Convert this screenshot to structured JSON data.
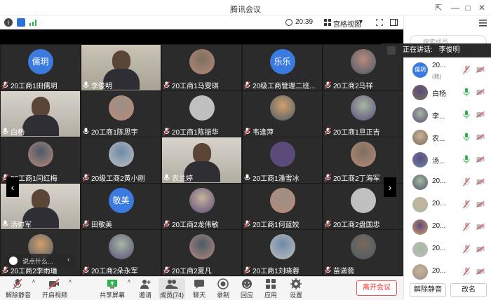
{
  "window": {
    "title": "腾讯会议",
    "pin": "⇱",
    "minimize": "—",
    "maximize": "□",
    "close": "✕"
  },
  "status": {
    "time": "20:39",
    "view": "宫格视图",
    "view_caret": "▾"
  },
  "video": {
    "prev_arrow": "‹",
    "next_arrow": "›",
    "tiles": [
      {
        "name": "20工商1田儒玥",
        "avatar_text": "儒玥",
        "muted": true
      },
      {
        "name": "李俊明",
        "video": true,
        "muted": false,
        "speaking": true
      },
      {
        "name": "20工商1马雯琪",
        "muted": true
      },
      {
        "name": "20级工商管理二班...",
        "avatar_text": "乐乐",
        "muted": true
      },
      {
        "name": "20工商2马祥",
        "muted": true
      },
      {
        "name": "白杨",
        "video": true,
        "muted": false
      },
      {
        "name": "20工商1陈思宇",
        "muted": false
      },
      {
        "name": "20工商1陈振华",
        "muted": true
      },
      {
        "name": "韦逢萍",
        "muted": true
      },
      {
        "name": "20工商1旦正吉",
        "muted": true
      },
      {
        "name": "20工商1闫红梅",
        "muted": true
      },
      {
        "name": "20级工商2黄小刚",
        "muted": true
      },
      {
        "name": "农兰婷",
        "video": true,
        "muted": false
      },
      {
        "name": "20工商1潘雪冰",
        "muted": false
      },
      {
        "name": "20工商2丁海军",
        "muted": true
      },
      {
        "name": "汤帅军",
        "video": true,
        "muted": false
      },
      {
        "name": "田敬美",
        "avatar_text": "敬美",
        "muted": true
      },
      {
        "name": "20工商2龙伟敏",
        "muted": true
      },
      {
        "name": "20工商1何蓝姣",
        "muted": true
      },
      {
        "name": "20工商2盘国忠",
        "muted": true
      },
      {
        "name": "20工商2李雨璠",
        "muted": true
      },
      {
        "name": "20工商2朵永军",
        "muted": true
      },
      {
        "name": "20工商2夏凡",
        "muted": true
      },
      {
        "name": "20工商1刘晓蓉",
        "muted": true
      },
      {
        "name": "苗潇蓊",
        "muted": true
      }
    ],
    "chat_placeholder": "说点什么..."
  },
  "toolbar": {
    "unmute": "解除静音",
    "start_video": "开启视频",
    "share": "共享屏幕",
    "invite": "邀请",
    "members": "成员(74)",
    "chat": "聊天",
    "record": "录制",
    "applause": "回应",
    "apps": "应用",
    "settings": "设置",
    "leave": "离开会议"
  },
  "panel": {
    "search_placeholder": "搜索成员",
    "speaking_label": "正在讲话:",
    "speaking_name": "李俊明",
    "participants": [
      {
        "name": "20...",
        "sub": "(我)",
        "avatar_text": "儒玥",
        "mic": "muted",
        "cam": "off"
      },
      {
        "name": "白杨",
        "mic": "on",
        "cam": "off"
      },
      {
        "name": "李...",
        "mic": "on",
        "cam": "off"
      },
      {
        "name": "农...",
        "mic": "on",
        "cam": "off"
      },
      {
        "name": "汤...",
        "mic": "on",
        "cam": "off"
      },
      {
        "name": "20...",
        "mic": "muted",
        "cam": "off"
      },
      {
        "name": "20...",
        "mic": "muted",
        "cam": "off"
      },
      {
        "name": "20...",
        "mic": "muted",
        "cam": "off"
      },
      {
        "name": "20...",
        "mic": "muted",
        "cam": "off"
      },
      {
        "name": "20...",
        "mic": "muted",
        "cam": "off"
      }
    ],
    "unmute_all": "解除静音",
    "rename": "改名"
  },
  "colors": {
    "accent": "#3b7be0",
    "speaking": "#3fc86a",
    "muted": "#e04b4b",
    "leave": "#e33333"
  }
}
